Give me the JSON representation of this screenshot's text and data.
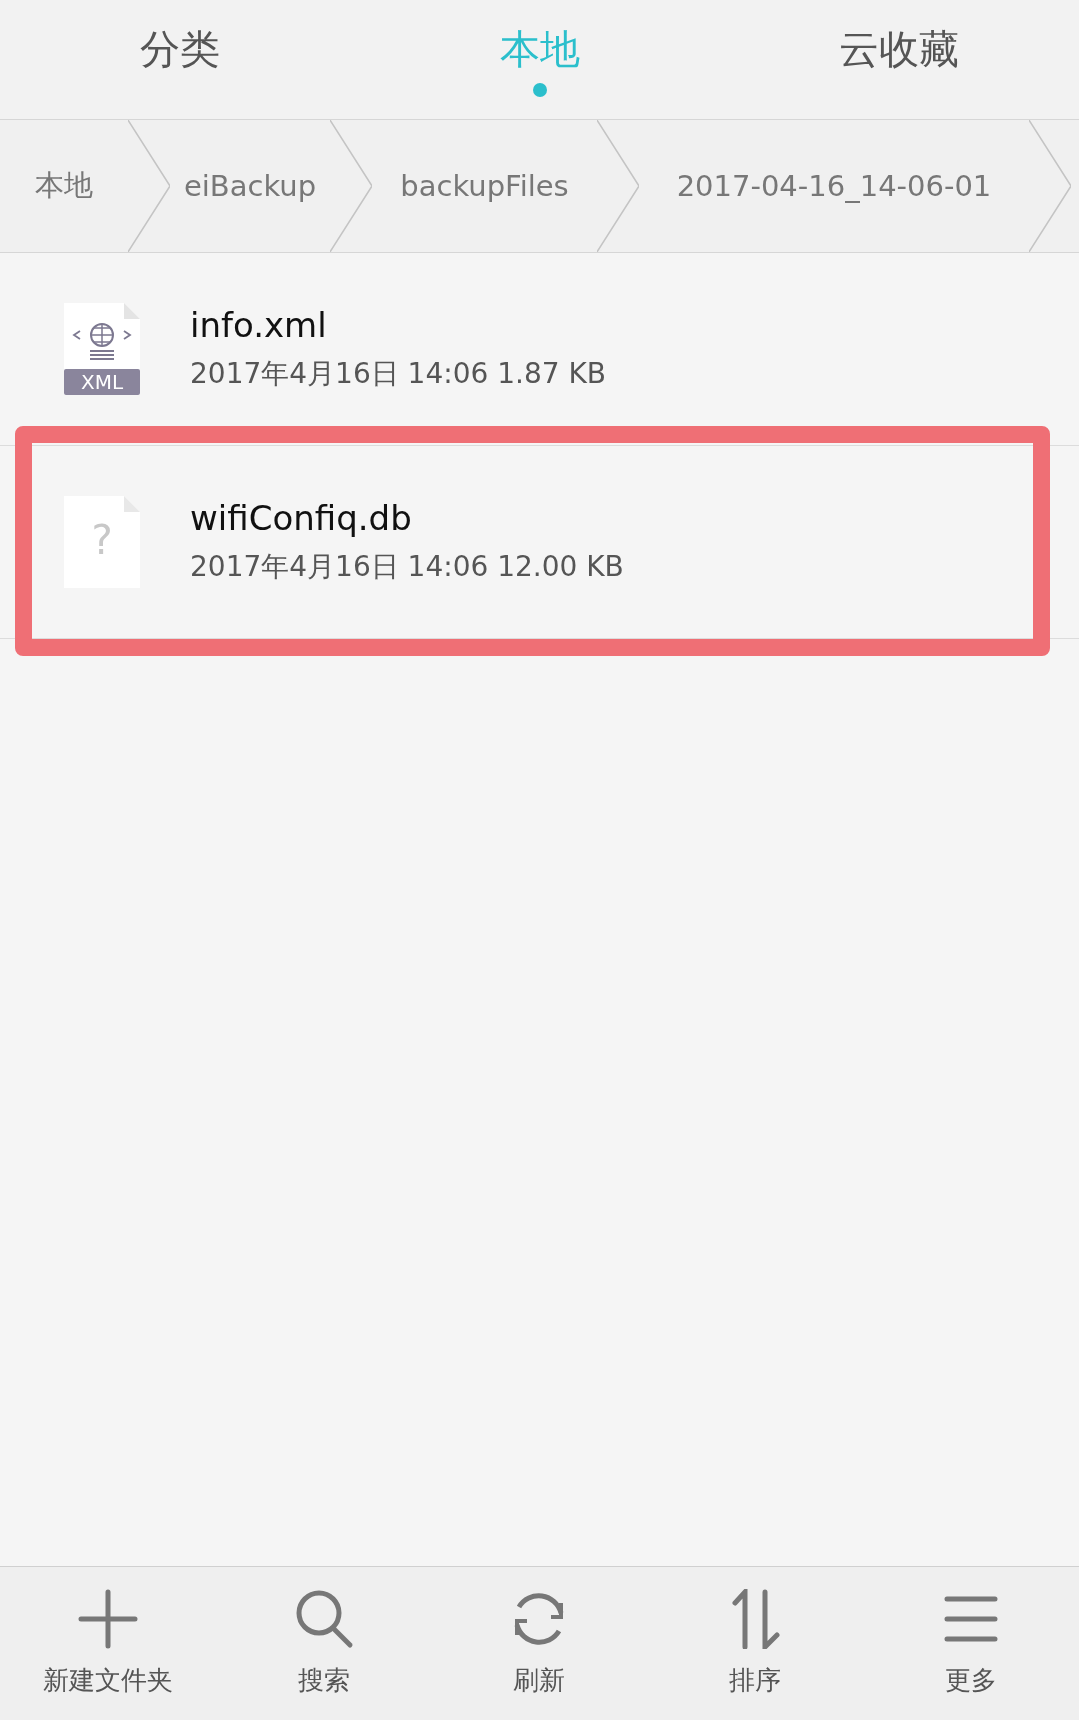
{
  "tabs": [
    {
      "label": "分类",
      "selected": false
    },
    {
      "label": "本地",
      "selected": true
    },
    {
      "label": "云收藏",
      "selected": false
    }
  ],
  "breadcrumbs": [
    "本地",
    "eiBackup",
    "backupFiles",
    "2017-04-16_14-06-01"
  ],
  "files": [
    {
      "kind": "xml",
      "badge": "XML",
      "name": "info.xml",
      "meta": "2017年4月16日 14:06 1.87 KB",
      "highlighted": false
    },
    {
      "kind": "unknown",
      "badge": "?",
      "name": "wifiConfiq.db",
      "meta": "2017年4月16日 14:06 12.00 KB",
      "highlighted": true
    }
  ],
  "toolbar": [
    {
      "kind": "add",
      "label": "新建文件夹"
    },
    {
      "kind": "search",
      "label": "搜索"
    },
    {
      "kind": "refresh",
      "label": "刷新"
    },
    {
      "kind": "sort",
      "label": "排序"
    },
    {
      "kind": "menu",
      "label": "更多"
    }
  ]
}
